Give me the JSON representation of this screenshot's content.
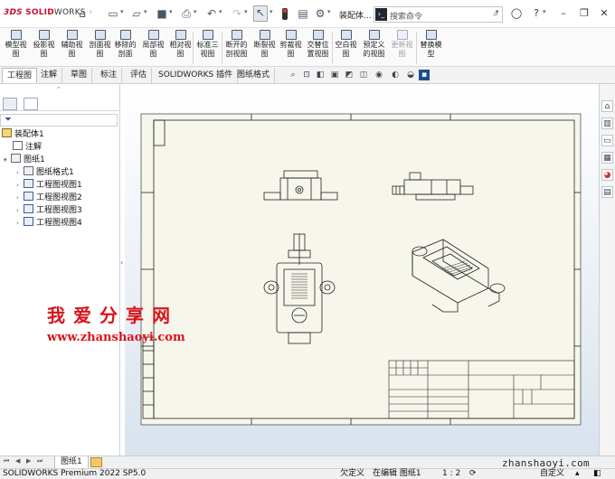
{
  "app": {
    "brand_prefix": "3DS",
    "brand_solid": "SOLID",
    "brand_works": "WORKS",
    "doc_title": "装配体..."
  },
  "search": {
    "placeholder": "搜索命令",
    "prompt_icon": "›_"
  },
  "toolbar_icons": [
    "home-icon",
    "new-file-icon",
    "open-icon",
    "save-icon",
    "print-icon",
    "undo-icon",
    "redo-icon",
    "select-icon",
    "traffic-light-icon",
    "file-props-icon",
    "gear-icon"
  ],
  "commands": [
    {
      "label": "模型视\n图",
      "enabled": true
    },
    {
      "label": "投影视\n图",
      "enabled": true
    },
    {
      "label": "辅助视\n图",
      "enabled": true
    },
    {
      "label": "剖面视\n图",
      "enabled": true
    },
    {
      "label": "移除的\n剖面",
      "enabled": true
    },
    {
      "label": "局部视\n图",
      "enabled": true
    },
    {
      "label": "相对视\n图",
      "enabled": true
    },
    {
      "label": "标准三\n视图",
      "enabled": true
    },
    {
      "label": "断开的\n剖视图",
      "enabled": true
    },
    {
      "label": "断裂视\n图",
      "enabled": true
    },
    {
      "label": "剪裁视\n图",
      "enabled": true
    },
    {
      "label": "交替位\n置视图",
      "enabled": true
    },
    {
      "label": "空白视\n图",
      "enabled": true
    },
    {
      "label": "预定义\n的视图",
      "enabled": true
    },
    {
      "label": "更新视\n图",
      "enabled": false
    },
    {
      "label": "替换模\n型",
      "enabled": true
    }
  ],
  "tabs": [
    "工程图",
    "注解",
    "草图",
    "标注",
    "评估",
    "SOLIDWORKS 插件",
    "图纸格式"
  ],
  "active_tab": "工程图",
  "tree": [
    {
      "label": "装配体1",
      "type": "asm",
      "indent": 0,
      "expander": ""
    },
    {
      "label": "注解",
      "type": "note",
      "indent": 1,
      "expander": ""
    },
    {
      "label": "图纸1",
      "type": "sheet",
      "indent": 1,
      "expander": "▾"
    },
    {
      "label": "图纸格式1",
      "type": "sheet",
      "indent": 2,
      "expander": "›"
    },
    {
      "label": "工程图视图1",
      "type": "view",
      "indent": 2,
      "expander": "›"
    },
    {
      "label": "工程图视图2",
      "type": "view",
      "indent": 2,
      "expander": "›"
    },
    {
      "label": "工程图视图3",
      "type": "view",
      "indent": 2,
      "expander": "›"
    },
    {
      "label": "工程图视图4",
      "type": "view",
      "indent": 2,
      "expander": "›"
    }
  ],
  "sheet_tab": "图纸1",
  "status": {
    "product": "SOLIDWORKS Premium 2022 SP5.0",
    "constraint": "欠定义",
    "editing": "在编辑 图纸1",
    "scale": "1 : 2",
    "custom": "自定义"
  },
  "watermark": {
    "cn": "我爱分享网",
    "url": "www.zhanshaoyi.com",
    "corner": "zhanshaoyi.com"
  },
  "colors": {
    "brand_red": "#c8102e",
    "watermark_red": "#d9131a",
    "sheet_bg": "#f7f6ec",
    "line": "#222222"
  }
}
